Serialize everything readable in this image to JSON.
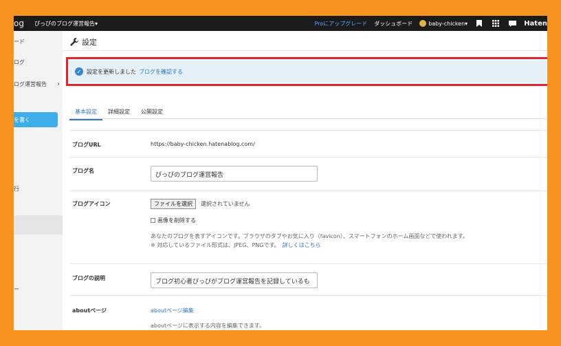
{
  "topbar": {
    "brand": "og",
    "blog_name": "ぴっぴのブログ運営報告▾",
    "pro_upgrade": "Proにアップグレード",
    "dashboard": "ダッシュボード",
    "username": "baby-chicken▾",
    "hatena": "Haten"
  },
  "sidebar": {
    "items": [
      {
        "label": "ード"
      },
      {
        "label": "ログ"
      },
      {
        "label": "ログ運営報告"
      },
      {
        "label": "を書く"
      },
      {
        "label": "行"
      },
      {
        "label": "ー"
      }
    ]
  },
  "main": {
    "title": "設定",
    "notice": {
      "message": "設定を更新しました",
      "link": "ブログを確認する"
    },
    "tabs": [
      {
        "label": "基本設定",
        "active": true
      },
      {
        "label": "詳細設定",
        "active": false
      },
      {
        "label": "公開設定",
        "active": false
      }
    ],
    "fields": {
      "url_label": "ブログURL",
      "url_value": "https://baby-chicken.hatenablog.com/",
      "name_label": "ブログ名",
      "name_value": "ぴっぴのブログ運営報告",
      "icon_label": "ブログアイコン",
      "file_button": "ファイルを選択",
      "file_status": "選択されていません",
      "delete_image": "画像を削除する",
      "icon_help": "あなたのブログを表すアイコンです。ブラウザのタブやお気に入り（favicon）、スマートフォンのホーム画面などで使われます。",
      "format_help": "※ 対応しているファイル形式は、JPEG、PNGです。",
      "format_link": "詳しくはこちら",
      "desc_label": "ブログの説明",
      "desc_value": "ブログ初心者ぴっぴがブログ運営報告を記録しているも",
      "about_label": "aboutページ",
      "about_link": "aboutページ編集",
      "about_help": "aboutページに表示する内容を編集できます。"
    }
  },
  "colors": {
    "background": "#f7931e",
    "topbar": "#1b1b1b",
    "accent": "#2d78c4",
    "notice_bg": "#e5f0f8",
    "highlight": "#e8232b",
    "write_button": "#3daee9"
  },
  "icons": [
    "wrench-icon",
    "check-circle-icon",
    "bookmark-icon",
    "grid-icon",
    "chat-icon"
  ]
}
